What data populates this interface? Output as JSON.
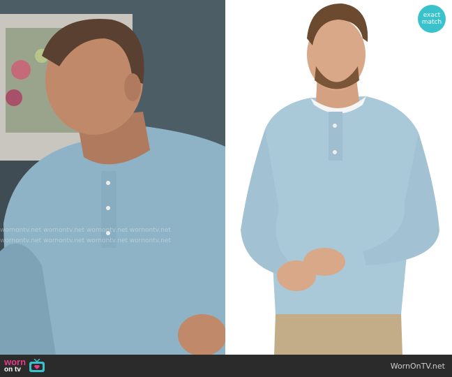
{
  "badge": {
    "line1": "exact",
    "line2": "match"
  },
  "footer": {
    "site": "WornOnTV.net",
    "logo_line1": "worn",
    "logo_line2": "on tv"
  },
  "watermark": {
    "row1": "wornontv.net  wornontv.net  wornontv.net  wornontv.net",
    "row2": "wornontv.net  wornontv.net  wornontv.net  wornontv.net"
  },
  "colors": {
    "shirt": "#8fb3c6",
    "badge": "#39c2cc",
    "logo": "#e63a8a",
    "footer": "#2b2b2b"
  }
}
